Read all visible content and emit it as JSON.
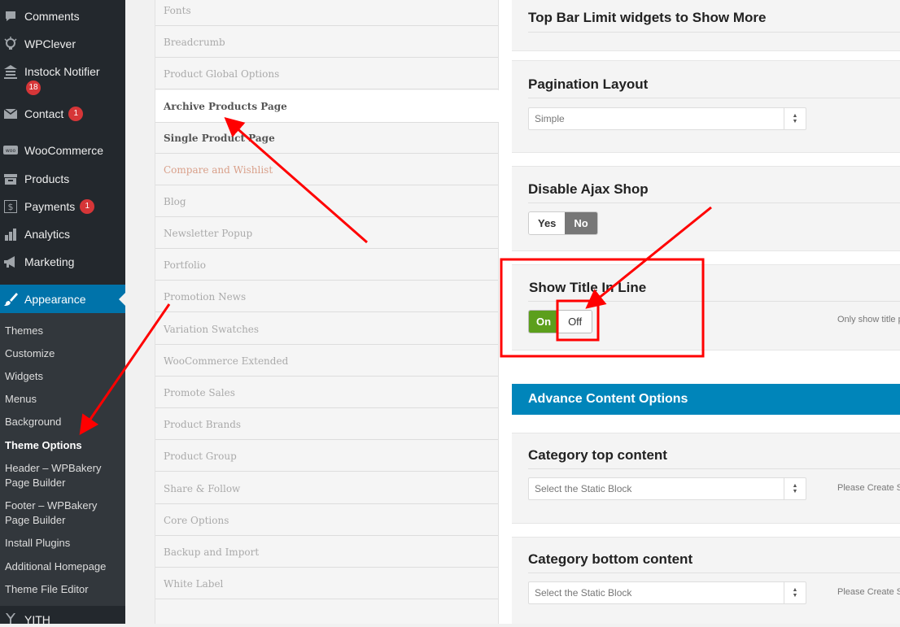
{
  "sidebar": {
    "items": [
      {
        "label": "Comments",
        "icon": "comment-icon"
      },
      {
        "label": "WPClever",
        "icon": "wpclever-icon"
      },
      {
        "label": "Instock Notifier",
        "icon": "instock-icon",
        "badge": "18"
      },
      {
        "label": "Contact",
        "icon": "mail-icon",
        "badge": "1"
      },
      {
        "label": "WooCommerce",
        "icon": "woo-icon"
      },
      {
        "label": "Products",
        "icon": "archive-icon"
      },
      {
        "label": "Payments",
        "icon": "dollar-icon",
        "badge": "1"
      },
      {
        "label": "Analytics",
        "icon": "bar-chart-icon"
      },
      {
        "label": "Marketing",
        "icon": "megaphone-icon"
      }
    ],
    "appearance": {
      "label": "Appearance",
      "icon": "brush-icon"
    },
    "submenu": [
      "Themes",
      "Customize",
      "Widgets",
      "Menus",
      "Background",
      "Theme Options",
      "Header – WPBakery Page Builder",
      "Footer – WPBakery Page Builder",
      "Install Plugins",
      "Additional Homepage",
      "Theme File Editor"
    ],
    "current_submenu": "Theme Options",
    "yith": {
      "label": "YITH",
      "icon": "yith-icon"
    }
  },
  "options_nav": {
    "items": [
      "Fonts",
      "Breadcrumb",
      "Product Global Options",
      "Archive Products Page",
      "Single Product Page",
      "Compare and Wishlist",
      "Blog",
      "Newsletter Popup",
      "Portfolio",
      "Promotion News",
      "Variation Swatches",
      "WooCommerce Extended",
      "Promote Sales",
      "Product Brands",
      "Product Group",
      "Share & Follow",
      "Core Options",
      "Backup and Import",
      "White Label"
    ],
    "active": "Archive Products Page"
  },
  "settings": {
    "top_bar": {
      "title": "Top Bar Limit widgets to Show More"
    },
    "pagination": {
      "title": "Pagination Layout",
      "value": "Simple"
    },
    "disable_ajax": {
      "title": "Disable Ajax Shop",
      "yes": "Yes",
      "no": "No",
      "selected": "No"
    },
    "show_title": {
      "title": "Show Title In Line",
      "on": "On",
      "off": "Off",
      "selected": "On",
      "help": "Only show title p"
    },
    "advance_banner": "Advance Content Options",
    "category_top": {
      "title": "Category top content",
      "placeholder": "Select the Static Block",
      "help": "Please Create S"
    },
    "category_bottom": {
      "title": "Category bottom content",
      "placeholder": "Select the Static Block",
      "help": "Please Create S"
    }
  },
  "colors": {
    "sidebar_bg": "#23282d",
    "submenu_bg": "#32373c",
    "accent": "#0073aa",
    "badge": "#d63638",
    "annotation": "#ff0000",
    "on_green": "#5c9f1c",
    "banner": "#0085ba"
  }
}
